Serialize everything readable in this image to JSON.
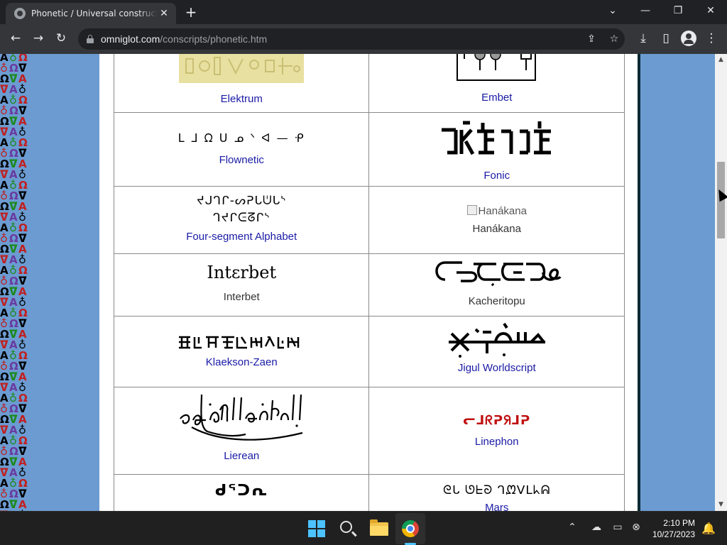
{
  "browser": {
    "tab_title": "Phonetic / Universal constructed",
    "tab_close": "✕",
    "new_tab": "+",
    "url_host": "omniglot.com",
    "url_path": "/conscripts/phonetic.htm",
    "window_controls": {
      "minimize": "—",
      "restore": "❐",
      "close": "✕",
      "tab_search": "⌄"
    },
    "nav": {
      "back": "←",
      "forward": "→",
      "reload": "↻"
    },
    "omnibox_icons": {
      "share": "⇪",
      "bookmark": "☆"
    },
    "toolbar_icons": {
      "download": "⤓",
      "sidepanel": "▯",
      "menu": "⋮"
    }
  },
  "page": {
    "rows": [
      {
        "left": {
          "name": "Elektrum",
          "link": true
        },
        "right": {
          "name": "Embet",
          "link": true
        }
      },
      {
        "left": {
          "name": "Flownetic",
          "link": true,
          "sample": "ᒪ ᒧ ᘯ ᑌ ᓄ ᐠ ᐊ — ᑶ"
        },
        "right": {
          "name": "Fonic",
          "link": true
        }
      },
      {
        "left": {
          "name": "Four-segment Alphabet",
          "link": true,
          "sample_lines": [
            "ᔪᒍᒉᒋ-ᔕᕈᒐᕫᒐᔅ",
            "ᒉᔪᒋᕮᘔᒋᔅ"
          ]
        },
        "right": {
          "name": "Hanákana",
          "link": false,
          "broken_alt": "Hanákana"
        }
      },
      {
        "left": {
          "name": "Interbet",
          "link": false,
          "sample": "Intɛrbet"
        },
        "right": {
          "name": "Kacheritopu",
          "link": false
        }
      },
      {
        "left": {
          "name": "Klaekson-Zaen",
          "link": true,
          "sample": "ꔹꔉꔫꔸꔲꔳꔴꔵ"
        },
        "right": {
          "name": "Jigul Worldscript",
          "link": true
        }
      },
      {
        "left": {
          "name": "Lierean",
          "link": true
        },
        "right": {
          "name": "Linephon",
          "link": true,
          "sample": "ᓕᒧᖇᕈᖆᒧᕈ"
        }
      },
      {
        "left": {
          "name": "",
          "link": false,
          "sample": "ᑯᕐᑐᕆ"
        },
        "right": {
          "name": "Mars",
          "link": true,
          "sample": "ᘓᒐ ᘎᖶᘐ ᒉᘻᐯᒪᖾᕱ"
        }
      }
    ],
    "accent_link_color": "#1a1aa6",
    "side_glyphs": [
      "A",
      "♁",
      "Ω",
      "ᐁ"
    ]
  },
  "taskbar": {
    "clock_time": "2:10 PM",
    "clock_date": "10/27/2023",
    "tray": {
      "chevron": "⌃",
      "onedrive": "☁",
      "display": "▭",
      "network": "⊗",
      "bell": "🔔"
    }
  }
}
